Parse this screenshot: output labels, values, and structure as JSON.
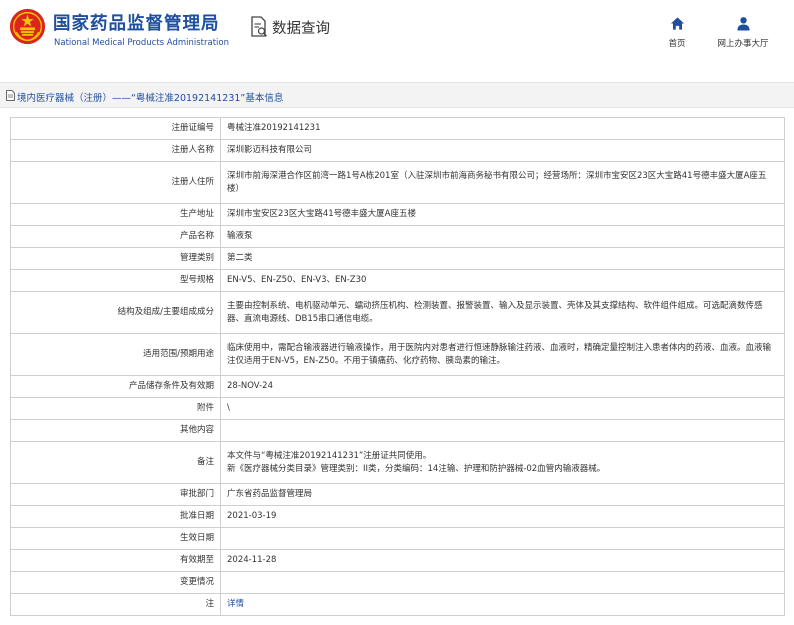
{
  "header": {
    "brand_cn": "国家药品监督管理局",
    "brand_en": "National Medical Products Administration",
    "search_label": "数据查询",
    "home_label": "首页",
    "hall_label": "网上办事大厅"
  },
  "breadcrumb": {
    "text": "境内医疗器械（注册）——“粤械注准20192141231”基本信息"
  },
  "rows": [
    {
      "label": "注册证编号",
      "value": "粤械注准20192141231"
    },
    {
      "label": "注册人名称",
      "value": "深圳影迈科技有限公司"
    },
    {
      "label": "注册人住所",
      "value": "深圳市前海深港合作区前湾一路1号A栋201室（入驻深圳市前海商务秘书有限公司；经营场所：深圳市宝安区23区大宝路41号德丰盛大厦A座五楼）"
    },
    {
      "label": "生产地址",
      "value": "深圳市宝安区23区大宝路41号德丰盛大厦A座五楼"
    },
    {
      "label": "产品名称",
      "value": "输液泵"
    },
    {
      "label": "管理类别",
      "value": "第二类"
    },
    {
      "label": "型号规格",
      "value": "EN-V5、EN-Z50、EN-V3、EN-Z30"
    },
    {
      "label": "结构及组成/主要组成成分",
      "value": "主要由控制系统、电机驱动单元、蠕动挤压机构、检测装置、报警装置、输入及显示装置、壳体及其支撑结构、软件组件组成。可选配滴数传感器、直流电源线、DB15串口通信电缆。"
    },
    {
      "label": "适用范围/预期用途",
      "value": "临床使用中，需配合输液器进行输液操作，用于医院内对患者进行恒速静脉输注药液、血液时，精确定量控制注入患者体内的药液、血液。血液输注仅适用于EN-V5，EN-Z50。不用于镇痛药、化疗药物、胰岛素的输注。"
    },
    {
      "label": "产品储存条件及有效期",
      "value": "28-NOV-24"
    },
    {
      "label": "附件",
      "value": "\\"
    },
    {
      "label": "其他内容",
      "value": ""
    },
    {
      "label": "备注",
      "value": "本文件与“粤械注准20192141231”注册证共同使用。\n新《医疗器械分类目录》管理类别：II类，分类编码：14注输、护理和防护器械-02血管内输液器械。"
    },
    {
      "label": "审批部门",
      "value": "广东省药品监督管理局"
    },
    {
      "label": "批准日期",
      "value": "2021-03-19"
    },
    {
      "label": "生效日期",
      "value": ""
    },
    {
      "label": "有效期至",
      "value": "2024-11-28"
    },
    {
      "label": "变更情况",
      "value": ""
    },
    {
      "label": "注",
      "value": "详情",
      "link": true
    }
  ]
}
